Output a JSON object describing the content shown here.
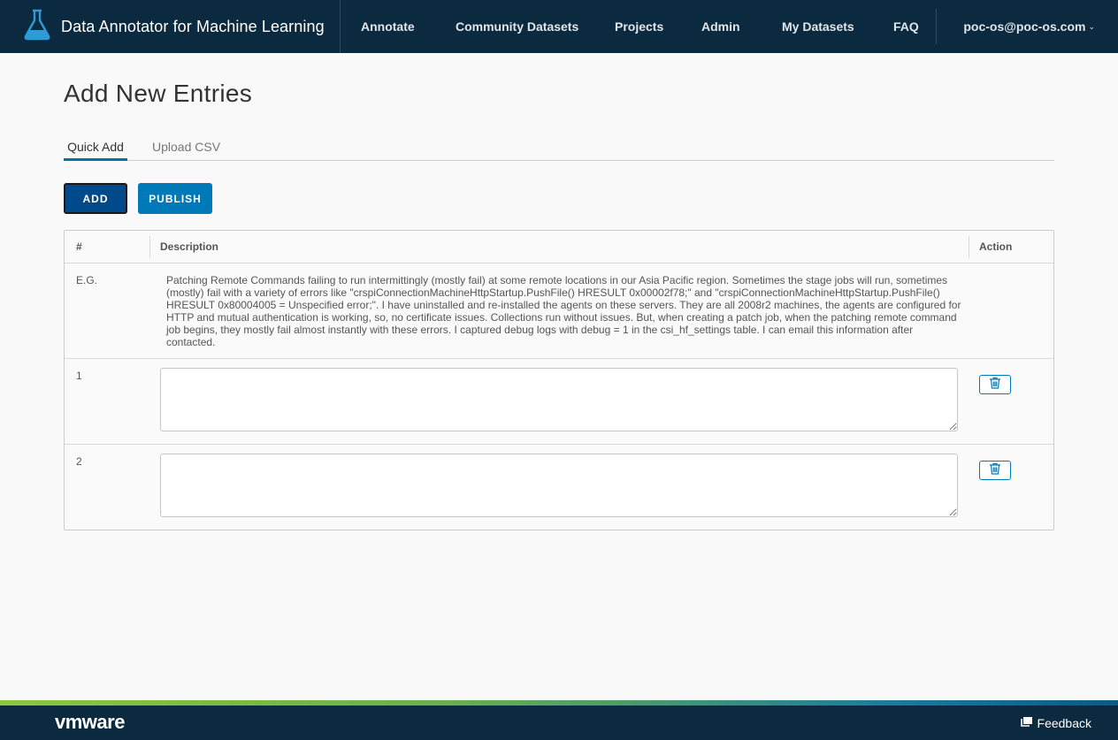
{
  "header": {
    "title": "Data Annotator for Machine Learning",
    "nav": [
      "Annotate",
      "Community Datasets",
      "Projects",
      "Admin",
      "My Datasets",
      "FAQ"
    ],
    "user": "poc-os@poc-os.com"
  },
  "page": {
    "title": "Add New Entries",
    "tabs": [
      "Quick Add",
      "Upload CSV"
    ],
    "active_tab": "Quick Add",
    "buttons": {
      "add": "ADD",
      "publish": "PUBLISH"
    }
  },
  "table": {
    "columns": [
      "#",
      "Description",
      "Action"
    ],
    "example": {
      "label": "E.G.",
      "text": "Patching Remote Commands failing to run intermittingly (mostly fail) at some remote locations in our Asia Pacific region. Sometimes the stage jobs will run, sometimes (mostly) fail with a variety of errors like \"crspiConnectionMachineHttpStartup.PushFile() HRESULT 0x00002f78;\" and \"crspiConnectionMachineHttpStartup.PushFile() HRESULT 0x80004005 = Unspecified error;\". I have uninstalled and re-installed the agents on these servers. They are all 2008r2 machines, the agents are configured for HTTP and mutual authentication is working, so, no certificate issues. Collections run without issues. But, when creating a patch job, when the patching remote command job begins, they mostly fail almost instantly with these errors. I captured debug logs with debug = 1 in the csi_hf_settings table. I can email this information after contacted."
    },
    "rows": [
      {
        "num": "1",
        "value": ""
      },
      {
        "num": "2",
        "value": ""
      }
    ]
  },
  "footer": {
    "logo": "vmware",
    "feedback": "Feedback"
  },
  "colors": {
    "header_bg": "#0c2a3f",
    "primary": "#0079b8",
    "add_button": "#004a8c"
  }
}
